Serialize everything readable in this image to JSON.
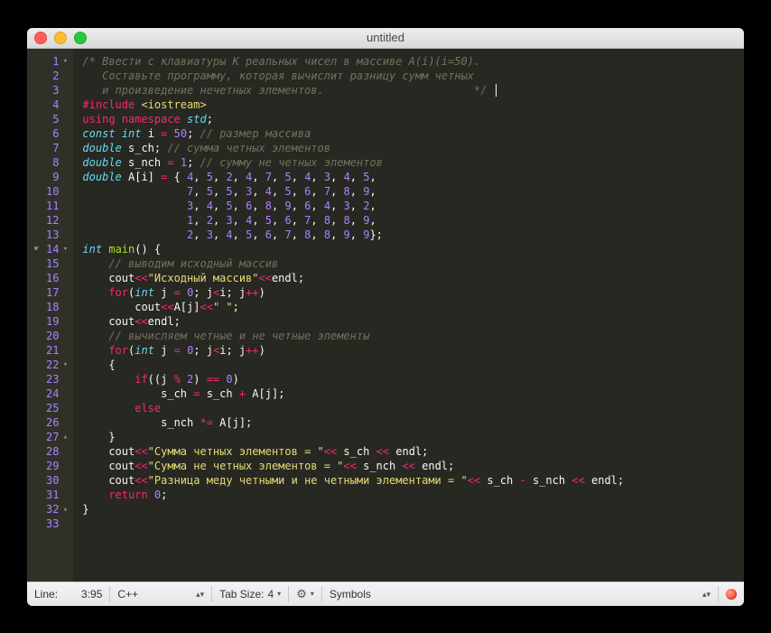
{
  "title": "untitled",
  "status": {
    "line_label": "Line:",
    "line_value": "3:95",
    "language": "C++",
    "tab_label": "Tab Size:",
    "tab_size": "4",
    "symbols": "Symbols"
  },
  "gutter": [
    {
      "n": "1",
      "a": "▾"
    },
    {
      "n": "2",
      "a": ""
    },
    {
      "n": "3",
      "a": ""
    },
    {
      "n": "4",
      "a": ""
    },
    {
      "n": "5",
      "a": ""
    },
    {
      "n": "6",
      "a": ""
    },
    {
      "n": "7",
      "a": ""
    },
    {
      "n": "8",
      "a": ""
    },
    {
      "n": "9",
      "a": ""
    },
    {
      "n": "10",
      "a": ""
    },
    {
      "n": "11",
      "a": ""
    },
    {
      "n": "12",
      "a": ""
    },
    {
      "n": "13",
      "a": ""
    },
    {
      "n": "14",
      "a": "▾",
      "hand": true
    },
    {
      "n": "15",
      "a": ""
    },
    {
      "n": "16",
      "a": ""
    },
    {
      "n": "17",
      "a": ""
    },
    {
      "n": "18",
      "a": ""
    },
    {
      "n": "19",
      "a": ""
    },
    {
      "n": "20",
      "a": ""
    },
    {
      "n": "21",
      "a": ""
    },
    {
      "n": "22",
      "a": "▾"
    },
    {
      "n": "23",
      "a": ""
    },
    {
      "n": "24",
      "a": ""
    },
    {
      "n": "25",
      "a": ""
    },
    {
      "n": "26",
      "a": ""
    },
    {
      "n": "27",
      "a": "▴"
    },
    {
      "n": "28",
      "a": ""
    },
    {
      "n": "29",
      "a": ""
    },
    {
      "n": "30",
      "a": ""
    },
    {
      "n": "31",
      "a": ""
    },
    {
      "n": "32",
      "a": "▴"
    },
    {
      "n": "33",
      "a": ""
    }
  ],
  "code": [
    [
      {
        "t": "/* Ввести с клавиатуры K реальных чисел в массиве A(i)(i=50).",
        "c": "c"
      }
    ],
    [
      {
        "t": "   Составьте программу, которая вычислит разницу сумм четных",
        "c": "c"
      }
    ],
    [
      {
        "t": "   и произведение нечетных элементов.                       */",
        "c": "c"
      },
      {
        "t": " ",
        "c": "id"
      },
      {
        "t": "|",
        "c": "cursor-mark"
      }
    ],
    [
      {
        "t": "#include",
        "c": "pp"
      },
      {
        "t": " ",
        "c": "id"
      },
      {
        "t": "<iostream>",
        "c": "inc"
      }
    ],
    [
      {
        "t": "using",
        "c": "kw2"
      },
      {
        "t": " ",
        "c": "id"
      },
      {
        "t": "namespace",
        "c": "kw2"
      },
      {
        "t": " ",
        "c": "id"
      },
      {
        "t": "std",
        "c": "kw"
      },
      {
        "t": ";",
        "c": "id"
      }
    ],
    [
      {
        "t": "const",
        "c": "kw"
      },
      {
        "t": " ",
        "c": "id"
      },
      {
        "t": "int",
        "c": "kw"
      },
      {
        "t": " i ",
        "c": "id"
      },
      {
        "t": "=",
        "c": "op"
      },
      {
        "t": " ",
        "c": "id"
      },
      {
        "t": "50",
        "c": "num"
      },
      {
        "t": ";",
        "c": "id"
      },
      {
        "t": " // размер массива",
        "c": "c"
      }
    ],
    [
      {
        "t": "double",
        "c": "kw"
      },
      {
        "t": " s_ch;",
        "c": "id"
      },
      {
        "t": " // сумма четных элементов",
        "c": "c"
      }
    ],
    [
      {
        "t": "double",
        "c": "kw"
      },
      {
        "t": " s_nch ",
        "c": "id"
      },
      {
        "t": "=",
        "c": "op"
      },
      {
        "t": " ",
        "c": "id"
      },
      {
        "t": "1",
        "c": "num"
      },
      {
        "t": ";",
        "c": "id"
      },
      {
        "t": " // сумму не четных элементов",
        "c": "c"
      }
    ],
    [
      {
        "t": "double",
        "c": "kw"
      },
      {
        "t": " A[i] ",
        "c": "id"
      },
      {
        "t": "=",
        "c": "op"
      },
      {
        "t": " { ",
        "c": "id"
      },
      {
        "t": "4",
        "c": "num"
      },
      {
        "t": ", ",
        "c": "id"
      },
      {
        "t": "5",
        "c": "num"
      },
      {
        "t": ", ",
        "c": "id"
      },
      {
        "t": "2",
        "c": "num"
      },
      {
        "t": ", ",
        "c": "id"
      },
      {
        "t": "4",
        "c": "num"
      },
      {
        "t": ", ",
        "c": "id"
      },
      {
        "t": "7",
        "c": "num"
      },
      {
        "t": ", ",
        "c": "id"
      },
      {
        "t": "5",
        "c": "num"
      },
      {
        "t": ", ",
        "c": "id"
      },
      {
        "t": "4",
        "c": "num"
      },
      {
        "t": ", ",
        "c": "id"
      },
      {
        "t": "3",
        "c": "num"
      },
      {
        "t": ", ",
        "c": "id"
      },
      {
        "t": "4",
        "c": "num"
      },
      {
        "t": ", ",
        "c": "id"
      },
      {
        "t": "5",
        "c": "num"
      },
      {
        "t": ",",
        "c": "id"
      }
    ],
    [
      {
        "t": "                ",
        "c": "id"
      },
      {
        "t": "7",
        "c": "num"
      },
      {
        "t": ", ",
        "c": "id"
      },
      {
        "t": "5",
        "c": "num"
      },
      {
        "t": ", ",
        "c": "id"
      },
      {
        "t": "5",
        "c": "num"
      },
      {
        "t": ", ",
        "c": "id"
      },
      {
        "t": "3",
        "c": "num"
      },
      {
        "t": ", ",
        "c": "id"
      },
      {
        "t": "4",
        "c": "num"
      },
      {
        "t": ", ",
        "c": "id"
      },
      {
        "t": "5",
        "c": "num"
      },
      {
        "t": ", ",
        "c": "id"
      },
      {
        "t": "6",
        "c": "num"
      },
      {
        "t": ", ",
        "c": "id"
      },
      {
        "t": "7",
        "c": "num"
      },
      {
        "t": ", ",
        "c": "id"
      },
      {
        "t": "8",
        "c": "num"
      },
      {
        "t": ", ",
        "c": "id"
      },
      {
        "t": "9",
        "c": "num"
      },
      {
        "t": ",",
        "c": "id"
      }
    ],
    [
      {
        "t": "                ",
        "c": "id"
      },
      {
        "t": "3",
        "c": "num"
      },
      {
        "t": ", ",
        "c": "id"
      },
      {
        "t": "4",
        "c": "num"
      },
      {
        "t": ", ",
        "c": "id"
      },
      {
        "t": "5",
        "c": "num"
      },
      {
        "t": ", ",
        "c": "id"
      },
      {
        "t": "6",
        "c": "num"
      },
      {
        "t": ", ",
        "c": "id"
      },
      {
        "t": "8",
        "c": "num"
      },
      {
        "t": ", ",
        "c": "id"
      },
      {
        "t": "9",
        "c": "num"
      },
      {
        "t": ", ",
        "c": "id"
      },
      {
        "t": "6",
        "c": "num"
      },
      {
        "t": ", ",
        "c": "id"
      },
      {
        "t": "4",
        "c": "num"
      },
      {
        "t": ", ",
        "c": "id"
      },
      {
        "t": "3",
        "c": "num"
      },
      {
        "t": ", ",
        "c": "id"
      },
      {
        "t": "2",
        "c": "num"
      },
      {
        "t": ",",
        "c": "id"
      }
    ],
    [
      {
        "t": "                ",
        "c": "id"
      },
      {
        "t": "1",
        "c": "num"
      },
      {
        "t": ", ",
        "c": "id"
      },
      {
        "t": "2",
        "c": "num"
      },
      {
        "t": ", ",
        "c": "id"
      },
      {
        "t": "3",
        "c": "num"
      },
      {
        "t": ", ",
        "c": "id"
      },
      {
        "t": "4",
        "c": "num"
      },
      {
        "t": ", ",
        "c": "id"
      },
      {
        "t": "5",
        "c": "num"
      },
      {
        "t": ", ",
        "c": "id"
      },
      {
        "t": "6",
        "c": "num"
      },
      {
        "t": ", ",
        "c": "id"
      },
      {
        "t": "7",
        "c": "num"
      },
      {
        "t": ", ",
        "c": "id"
      },
      {
        "t": "8",
        "c": "num"
      },
      {
        "t": ", ",
        "c": "id"
      },
      {
        "t": "8",
        "c": "num"
      },
      {
        "t": ", ",
        "c": "id"
      },
      {
        "t": "9",
        "c": "num"
      },
      {
        "t": ",",
        "c": "id"
      }
    ],
    [
      {
        "t": "                ",
        "c": "id"
      },
      {
        "t": "2",
        "c": "num"
      },
      {
        "t": ", ",
        "c": "id"
      },
      {
        "t": "3",
        "c": "num"
      },
      {
        "t": ", ",
        "c": "id"
      },
      {
        "t": "4",
        "c": "num"
      },
      {
        "t": ", ",
        "c": "id"
      },
      {
        "t": "5",
        "c": "num"
      },
      {
        "t": ", ",
        "c": "id"
      },
      {
        "t": "6",
        "c": "num"
      },
      {
        "t": ", ",
        "c": "id"
      },
      {
        "t": "7",
        "c": "num"
      },
      {
        "t": ", ",
        "c": "id"
      },
      {
        "t": "8",
        "c": "num"
      },
      {
        "t": ", ",
        "c": "id"
      },
      {
        "t": "8",
        "c": "num"
      },
      {
        "t": ", ",
        "c": "id"
      },
      {
        "t": "9",
        "c": "num"
      },
      {
        "t": ", ",
        "c": "id"
      },
      {
        "t": "9",
        "c": "num"
      },
      {
        "t": "};",
        "c": "id"
      }
    ],
    [
      {
        "t": "int",
        "c": "kw"
      },
      {
        "t": " ",
        "c": "id"
      },
      {
        "t": "main",
        "c": "fn"
      },
      {
        "t": "() {",
        "c": "id"
      }
    ],
    [
      {
        "t": "    ",
        "c": "id"
      },
      {
        "t": "// выводим исходный массив",
        "c": "c"
      }
    ],
    [
      {
        "t": "    cout",
        "c": "id"
      },
      {
        "t": "<<",
        "c": "op"
      },
      {
        "t": "\"Исходный массив\"",
        "c": "str"
      },
      {
        "t": "<<",
        "c": "op"
      },
      {
        "t": "endl;",
        "c": "id"
      }
    ],
    [
      {
        "t": "    ",
        "c": "id"
      },
      {
        "t": "for",
        "c": "kw2"
      },
      {
        "t": "(",
        "c": "id"
      },
      {
        "t": "int",
        "c": "kw"
      },
      {
        "t": " j ",
        "c": "id"
      },
      {
        "t": "=",
        "c": "op"
      },
      {
        "t": " ",
        "c": "id"
      },
      {
        "t": "0",
        "c": "num"
      },
      {
        "t": "; j",
        "c": "id"
      },
      {
        "t": "<",
        "c": "op"
      },
      {
        "t": "i; j",
        "c": "id"
      },
      {
        "t": "++",
        "c": "op"
      },
      {
        "t": ")",
        "c": "id"
      }
    ],
    [
      {
        "t": "        cout",
        "c": "id"
      },
      {
        "t": "<<",
        "c": "op"
      },
      {
        "t": "A[j]",
        "c": "id"
      },
      {
        "t": "<<",
        "c": "op"
      },
      {
        "t": "\" \"",
        "c": "str"
      },
      {
        "t": ";",
        "c": "id"
      }
    ],
    [
      {
        "t": "    cout",
        "c": "id"
      },
      {
        "t": "<<",
        "c": "op"
      },
      {
        "t": "endl;",
        "c": "id"
      }
    ],
    [
      {
        "t": "    ",
        "c": "id"
      },
      {
        "t": "// вычисляем четные и не четные элементы",
        "c": "c"
      }
    ],
    [
      {
        "t": "    ",
        "c": "id"
      },
      {
        "t": "for",
        "c": "kw2"
      },
      {
        "t": "(",
        "c": "id"
      },
      {
        "t": "int",
        "c": "kw"
      },
      {
        "t": " j ",
        "c": "id"
      },
      {
        "t": "=",
        "c": "op"
      },
      {
        "t": " ",
        "c": "id"
      },
      {
        "t": "0",
        "c": "num"
      },
      {
        "t": "; j",
        "c": "id"
      },
      {
        "t": "<",
        "c": "op"
      },
      {
        "t": "i; j",
        "c": "id"
      },
      {
        "t": "++",
        "c": "op"
      },
      {
        "t": ")",
        "c": "id"
      }
    ],
    [
      {
        "t": "    {",
        "c": "id"
      }
    ],
    [
      {
        "t": "        ",
        "c": "id"
      },
      {
        "t": "if",
        "c": "kw2"
      },
      {
        "t": "((j ",
        "c": "id"
      },
      {
        "t": "%",
        "c": "op"
      },
      {
        "t": " ",
        "c": "id"
      },
      {
        "t": "2",
        "c": "num"
      },
      {
        "t": ") ",
        "c": "id"
      },
      {
        "t": "==",
        "c": "op"
      },
      {
        "t": " ",
        "c": "id"
      },
      {
        "t": "0",
        "c": "num"
      },
      {
        "t": ")",
        "c": "id"
      }
    ],
    [
      {
        "t": "            s_ch ",
        "c": "id"
      },
      {
        "t": "=",
        "c": "op"
      },
      {
        "t": " s_ch ",
        "c": "id"
      },
      {
        "t": "+",
        "c": "op"
      },
      {
        "t": " A[j];",
        "c": "id"
      }
    ],
    [
      {
        "t": "        ",
        "c": "id"
      },
      {
        "t": "else",
        "c": "kw2"
      }
    ],
    [
      {
        "t": "            s_nch ",
        "c": "id"
      },
      {
        "t": "*=",
        "c": "op"
      },
      {
        "t": " A[j];",
        "c": "id"
      }
    ],
    [
      {
        "t": "    }",
        "c": "id"
      }
    ],
    [
      {
        "t": "    cout",
        "c": "id"
      },
      {
        "t": "<<",
        "c": "op"
      },
      {
        "t": "\"Сумма четных элементов = \"",
        "c": "str"
      },
      {
        "t": "<<",
        "c": "op"
      },
      {
        "t": " s_ch ",
        "c": "id"
      },
      {
        "t": "<<",
        "c": "op"
      },
      {
        "t": " endl;",
        "c": "id"
      }
    ],
    [
      {
        "t": "    cout",
        "c": "id"
      },
      {
        "t": "<<",
        "c": "op"
      },
      {
        "t": "\"Сумма не четных элементов = \"",
        "c": "str"
      },
      {
        "t": "<<",
        "c": "op"
      },
      {
        "t": " s_nch ",
        "c": "id"
      },
      {
        "t": "<<",
        "c": "op"
      },
      {
        "t": " endl;",
        "c": "id"
      }
    ],
    [
      {
        "t": "    cout",
        "c": "id"
      },
      {
        "t": "<<",
        "c": "op"
      },
      {
        "t": "\"Разница меду четными и не четными элементами = \"",
        "c": "str"
      },
      {
        "t": "<<",
        "c": "op"
      },
      {
        "t": " s_ch ",
        "c": "id"
      },
      {
        "t": "-",
        "c": "op"
      },
      {
        "t": " s_nch ",
        "c": "id"
      },
      {
        "t": "<<",
        "c": "op"
      },
      {
        "t": " endl;",
        "c": "id"
      }
    ],
    [
      {
        "t": "    ",
        "c": "id"
      },
      {
        "t": "return",
        "c": "kw2"
      },
      {
        "t": " ",
        "c": "id"
      },
      {
        "t": "0",
        "c": "num"
      },
      {
        "t": ";",
        "c": "id"
      }
    ],
    [
      {
        "t": "}",
        "c": "id"
      }
    ],
    [
      {
        "t": "",
        "c": "id"
      }
    ]
  ]
}
